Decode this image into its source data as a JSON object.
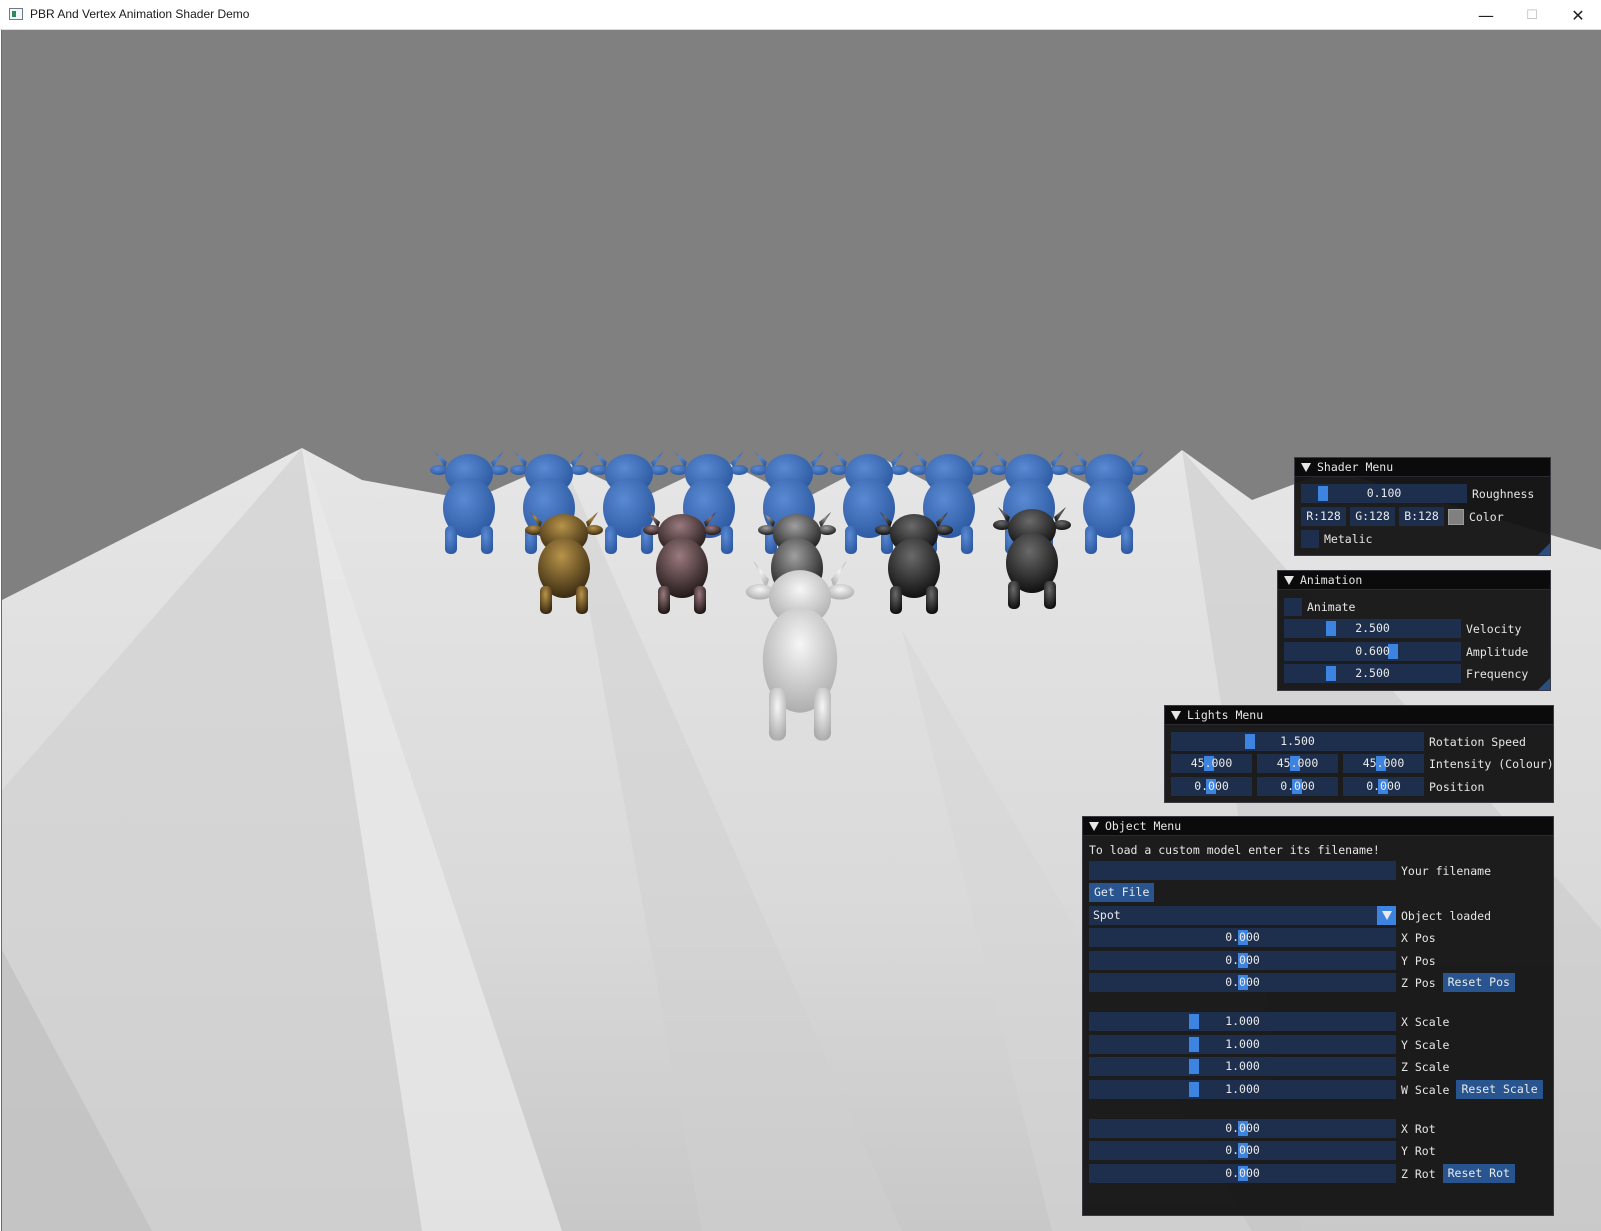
{
  "window": {
    "title": "PBR And Vertex Animation Shader Demo",
    "minimize_glyph": "—",
    "maximize_glyph": "☐",
    "close_glyph": "✕"
  },
  "scene": {
    "sky_color": "#808080",
    "terrain_color": "#e2e2e2",
    "back_row_color": "#3a6bb5",
    "front_row_colors": [
      "#6b5124",
      "#4a3838",
      "#3c3c3c",
      "#2a2a2a",
      "#262626"
    ],
    "center_model_color": "#dcdcdc"
  },
  "shader_menu": {
    "title": "Shader Menu",
    "roughness": {
      "value": "0.100",
      "label": "Roughness",
      "fraction": 0.1
    },
    "color": {
      "r": "R:128",
      "g": "G:128",
      "b": "B:128",
      "label": "Color",
      "swatch": "#808080"
    },
    "metalic": {
      "label": "Metalic",
      "checked": false
    }
  },
  "animation": {
    "title": "Animation",
    "animate": {
      "label": "Animate",
      "checked": false
    },
    "velocity": {
      "value": "2.500",
      "label": "Velocity"
    },
    "amplitude": {
      "value": "0.600",
      "label": "Amplitude"
    },
    "frequency": {
      "value": "2.500",
      "label": "Frequency"
    }
  },
  "lights_menu": {
    "title": "Lights Menu",
    "rotation_speed": {
      "value": "1.500",
      "label": "Rotation Speed"
    },
    "intensity": {
      "values": [
        "45.000",
        "45.000",
        "45.000"
      ],
      "label": "Intensity (Colour)"
    },
    "position": {
      "values": [
        "0.000",
        "0.000",
        "0.000"
      ],
      "label": "Position"
    }
  },
  "object_menu": {
    "title": "Object Menu",
    "hint": "To load a custom model enter its filename!",
    "filename": {
      "value": "",
      "label": "Your filename"
    },
    "get_file": "Get File",
    "object_loaded": {
      "value": "Spot",
      "label": "Object loaded"
    },
    "position": {
      "x": {
        "value": "0.000",
        "label": "X Pos"
      },
      "y": {
        "value": "0.000",
        "label": "Y Pos"
      },
      "z": {
        "value": "0.000",
        "label": "Z Pos"
      },
      "reset": "Reset Pos"
    },
    "scale": {
      "x": {
        "value": "1.000",
        "label": "X Scale"
      },
      "y": {
        "value": "1.000",
        "label": "Y Scale"
      },
      "z": {
        "value": "1.000",
        "label": "Z Scale"
      },
      "w": {
        "value": "1.000",
        "label": "W Scale"
      },
      "reset": "Reset Scale"
    },
    "rotation": {
      "x": {
        "value": "0.000",
        "label": "X Rot"
      },
      "y": {
        "value": "0.000",
        "label": "Y Rot"
      },
      "z": {
        "value": "0.000",
        "label": "Z Rot"
      },
      "reset": "Reset Rot"
    }
  }
}
